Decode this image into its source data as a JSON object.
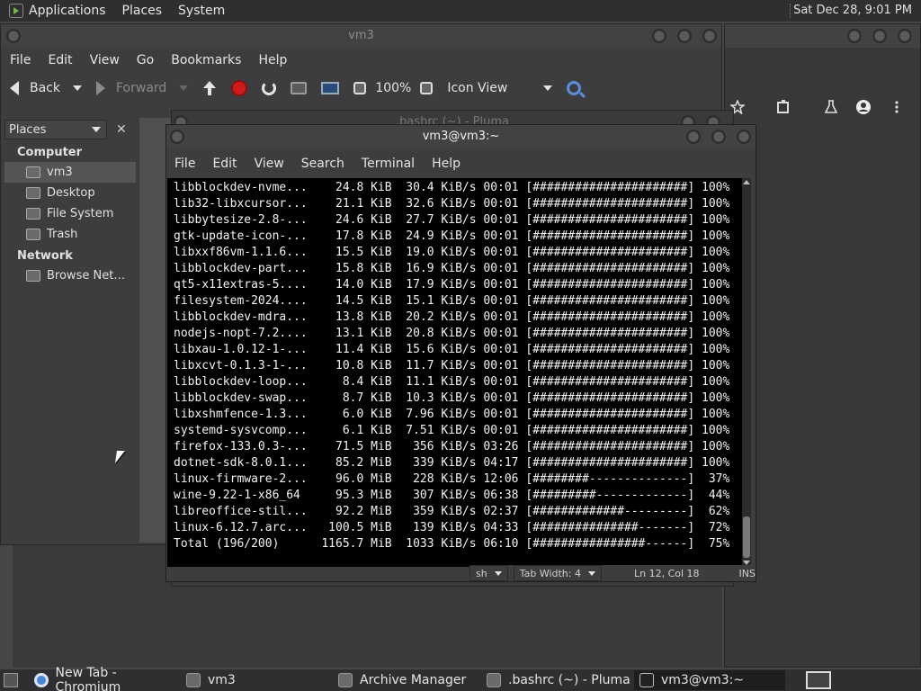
{
  "top_panel": {
    "menus": [
      "Applications",
      "Places",
      "System"
    ],
    "clock": "Sat Dec 28,  9:01 PM"
  },
  "file_manager": {
    "title": "vm3",
    "menus": [
      "File",
      "Edit",
      "View",
      "Go",
      "Bookmarks",
      "Help"
    ],
    "toolbar": {
      "back": "Back",
      "forward": "Forward",
      "zoom": "100%",
      "view_mode": "Icon View"
    },
    "places_label": "Places",
    "sidebar": {
      "computer_heading": "Computer",
      "computer_items": [
        "vm3",
        "Desktop",
        "File System",
        "Trash"
      ],
      "network_heading": "Network",
      "network_items": [
        "Browse Net…"
      ]
    }
  },
  "pluma": {
    "title": ".bashrc (~) - Pluma",
    "status": {
      "language": "sh",
      "tab_width": "Tab Width:  4",
      "position": "Ln 12, Col 18",
      "mode": "INS"
    }
  },
  "terminal": {
    "title": "vm3@vm3:~",
    "menus": [
      "File",
      "Edit",
      "View",
      "Search",
      "Terminal",
      "Help"
    ],
    "lines": [
      "libblockdev-nvme...    24.8 KiB  30.4 KiB/s 00:01 [######################] 100%",
      "lib32-libxcursor...    21.1 KiB  32.6 KiB/s 00:01 [######################] 100%",
      "libbytesize-2.8-...    24.6 KiB  27.7 KiB/s 00:01 [######################] 100%",
      "gtk-update-icon-...    17.8 KiB  24.9 KiB/s 00:01 [######################] 100%",
      "libxxf86vm-1.1.6...    15.5 KiB  19.0 KiB/s 00:01 [######################] 100%",
      "libblockdev-part...    15.8 KiB  16.9 KiB/s 00:01 [######################] 100%",
      "qt5-x11extras-5....    14.0 KiB  17.9 KiB/s 00:01 [######################] 100%",
      "filesystem-2024....    14.5 KiB  15.1 KiB/s 00:01 [######################] 100%",
      "libblockdev-mdra...    13.8 KiB  20.2 KiB/s 00:01 [######################] 100%",
      "nodejs-nopt-7.2....    13.1 KiB  20.8 KiB/s 00:01 [######################] 100%",
      "libxau-1.0.12-1-...    11.4 KiB  15.6 KiB/s 00:01 [######################] 100%",
      "libxcvt-0.1.3-1-...    10.8 KiB  11.7 KiB/s 00:01 [######################] 100%",
      "libblockdev-loop...     8.4 KiB  11.1 KiB/s 00:01 [######################] 100%",
      "libblockdev-swap...     8.7 KiB  10.3 KiB/s 00:01 [######################] 100%",
      "libxshmfence-1.3...     6.0 KiB  7.96 KiB/s 00:01 [######################] 100%",
      "systemd-sysvcomp...     6.1 KiB  7.51 KiB/s 00:01 [######################] 100%",
      "firefox-133.0.3-...    71.5 MiB   356 KiB/s 03:26 [######################] 100%",
      "dotnet-sdk-8.0.1...    85.2 MiB   339 KiB/s 04:17 [######################] 100%",
      "linux-firmware-2...    96.0 MiB   228 KiB/s 12:06 [########--------------]  37%",
      "wine-9.22-1-x86_64     95.3 MiB   307 KiB/s 06:38 [#########-------------]  44%",
      "libreoffice-stil...    92.2 MiB   359 KiB/s 02:37 [#############---------]  62%",
      "linux-6.12.7.arc...   100.5 MiB   139 KiB/s 04:33 [###############-------]  72%",
      "Total (196/200)      1165.7 MiB  1033 KiB/s 06:10 [################------]  75%"
    ]
  },
  "taskbar": {
    "tasks": [
      "New Tab - Chromium",
      "vm3",
      "Archive Manager",
      ".bashrc (~) - Pluma",
      "vm3@vm3:~"
    ]
  }
}
